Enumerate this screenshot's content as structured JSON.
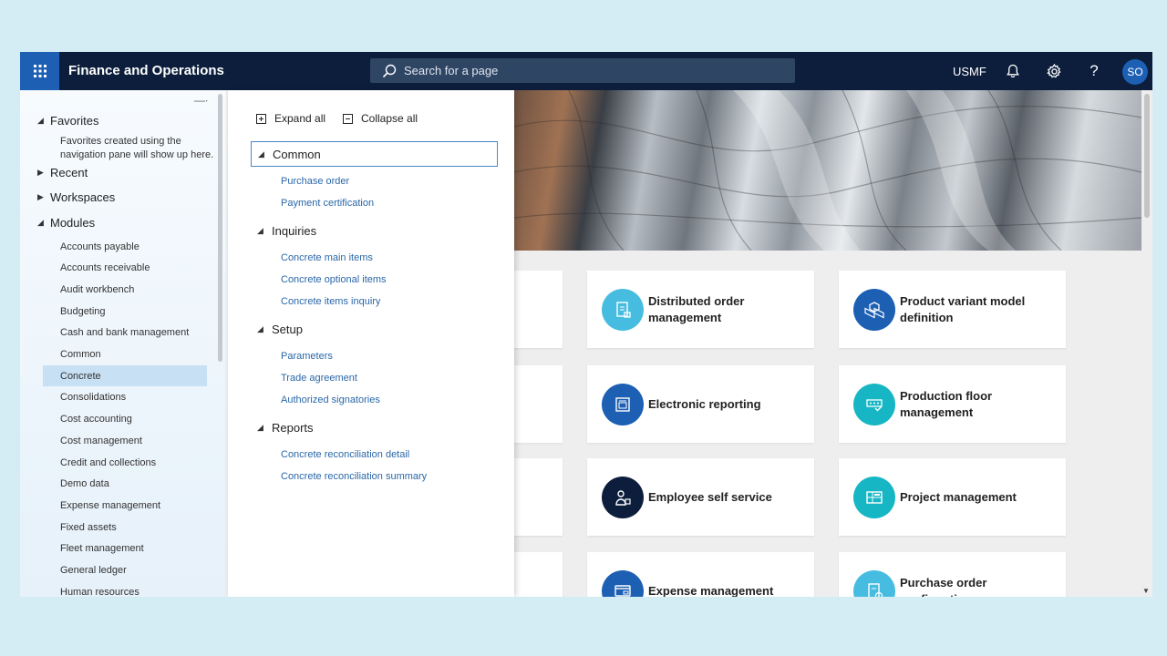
{
  "topbar": {
    "app_title": "Finance and Operations",
    "search_placeholder": "Search for a page",
    "company": "USMF",
    "avatar_initials": "SO"
  },
  "nav": {
    "favorites_label": "Favorites",
    "favorites_note": "Favorites created using the navigation pane will show up here.",
    "recent_label": "Recent",
    "workspaces_label": "Workspaces",
    "modules_label": "Modules",
    "modules": [
      "Accounts payable",
      "Accounts receivable",
      "Audit workbench",
      "Budgeting",
      "Cash and bank management",
      "Common",
      "Concrete",
      "Consolidations",
      "Cost accounting",
      "Cost management",
      "Credit and collections",
      "Demo data",
      "Expense management",
      "Fixed assets",
      "Fleet management",
      "General ledger",
      "Human resources"
    ],
    "selected_module": "Concrete"
  },
  "flyout": {
    "expand_all": "Expand all",
    "collapse_all": "Collapse all",
    "groups": [
      {
        "title": "Common",
        "items": [
          "Purchase order",
          "Payment certification"
        ]
      },
      {
        "title": "Inquiries",
        "items": [
          "Concrete main items",
          "Concrete optional items",
          "Concrete items inquiry"
        ]
      },
      {
        "title": "Setup",
        "items": [
          "Parameters",
          "Trade agreement",
          "Authorized signatories"
        ]
      },
      {
        "title": "Reports",
        "items": [
          "Concrete reconciliation detail",
          "Concrete reconciliation summary"
        ]
      }
    ]
  },
  "tiles": [
    {
      "label": "Distributed order management",
      "icon": "document-flow-icon",
      "color": "#46bde0"
    },
    {
      "label": "Product variant model definition",
      "icon": "cubes-icon",
      "color": "#1c5fb3"
    },
    {
      "label": "Electronic reporting",
      "icon": "report-document-icon",
      "color": "#1c5fb3"
    },
    {
      "label": "Production floor management",
      "icon": "factory-floor-icon",
      "color": "#16b6c4"
    },
    {
      "label": "Employee self service",
      "icon": "person-icon",
      "color": "#0c1e3c"
    },
    {
      "label": "Project management",
      "icon": "project-board-icon",
      "color": "#16b6c4"
    },
    {
      "label": "Expense management",
      "icon": "expense-card-icon",
      "color": "#1c5fb3"
    },
    {
      "label": "Purchase order confirmation",
      "icon": "order-document-icon",
      "color": "#46bde0"
    }
  ],
  "colors": {
    "topbar": "#0c1e3c",
    "accent": "#1c5fb3",
    "link": "#2a67a8",
    "selection": "#c7e0f4"
  }
}
